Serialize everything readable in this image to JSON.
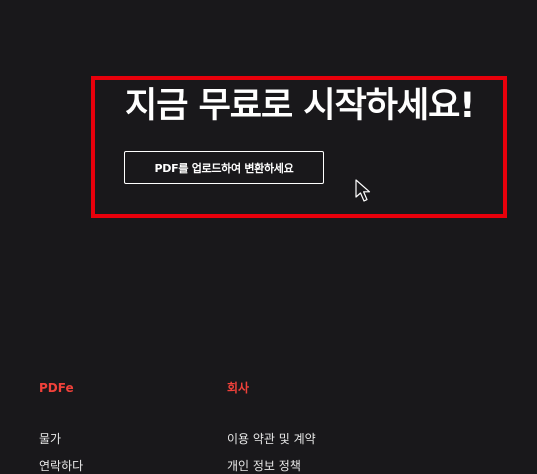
{
  "hero": {
    "title": "지금 무료로 시작하세요!",
    "cta_label": "PDF를 업로드하여 변환하세요"
  },
  "footer": {
    "columns": [
      {
        "heading": "PDFe",
        "links": [
          "물가",
          "연락하다"
        ]
      },
      {
        "heading": "회사",
        "links": [
          "이용 약관 및 계약",
          "개인 정보 정책"
        ]
      }
    ]
  },
  "colors": {
    "background": "#19181b",
    "highlight": "#e8000b",
    "accent": "#f0413a",
    "text": "#ffffff"
  },
  "icons": {
    "cursor": "mouse-pointer-icon"
  }
}
